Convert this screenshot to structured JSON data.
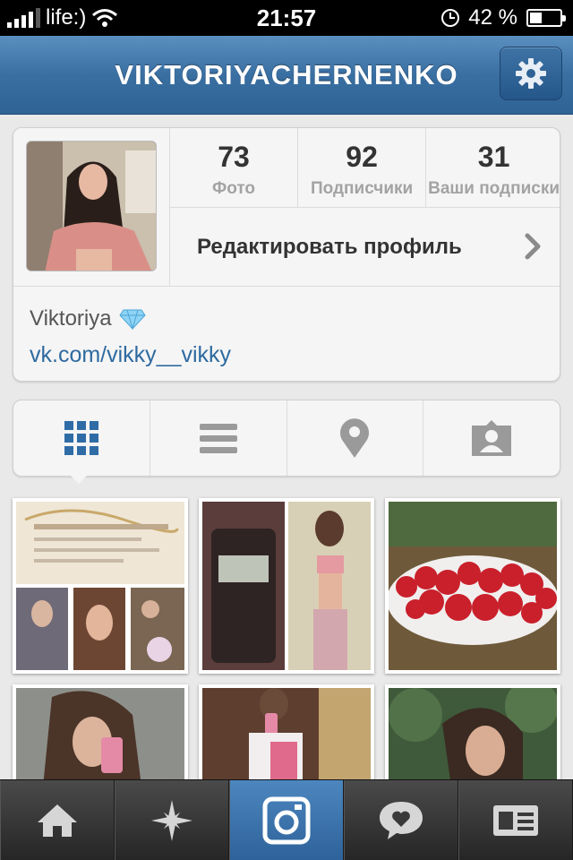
{
  "status_bar": {
    "carrier": "life:)",
    "time": "21:57",
    "battery": "42 %",
    "battery_level": 0.42
  },
  "header": {
    "username": "VIKTORIYACHERNENKO",
    "settings_icon": "gear-icon"
  },
  "profile": {
    "stats": [
      {
        "value": "73",
        "label": "Фото"
      },
      {
        "value": "92",
        "label": "Подписчики"
      },
      {
        "value": "31",
        "label": "Ваши подписки"
      }
    ],
    "edit_label": "Редактировать профиль",
    "name": "Viktoriya",
    "name_emoji": "diamond-icon",
    "link": "vk.com/vikky__vikky"
  },
  "view_tabs": [
    {
      "icon": "grid-icon",
      "active": true
    },
    {
      "icon": "list-icon",
      "active": false
    },
    {
      "icon": "location-pin-icon",
      "active": false
    },
    {
      "icon": "tagged-person-icon",
      "active": false
    }
  ],
  "photos": [
    {
      "desc": "certificate collage"
    },
    {
      "desc": "scale and mirror selfie"
    },
    {
      "desc": "strawberries on plate"
    },
    {
      "desc": "selfie with pink phone"
    },
    {
      "desc": "mirror selfie"
    },
    {
      "desc": "outdoor portrait"
    }
  ],
  "tab_bar": [
    {
      "icon": "home-icon",
      "active": false
    },
    {
      "icon": "explore-star-icon",
      "active": false
    },
    {
      "icon": "camera-icon",
      "active": true
    },
    {
      "icon": "news-heart-icon",
      "active": false
    },
    {
      "icon": "profile-card-icon",
      "active": false
    }
  ],
  "colors": {
    "nav_blue": "#3a6fa2",
    "link_blue": "#2e6aa0",
    "active_tab_blue": "#2e629a"
  }
}
